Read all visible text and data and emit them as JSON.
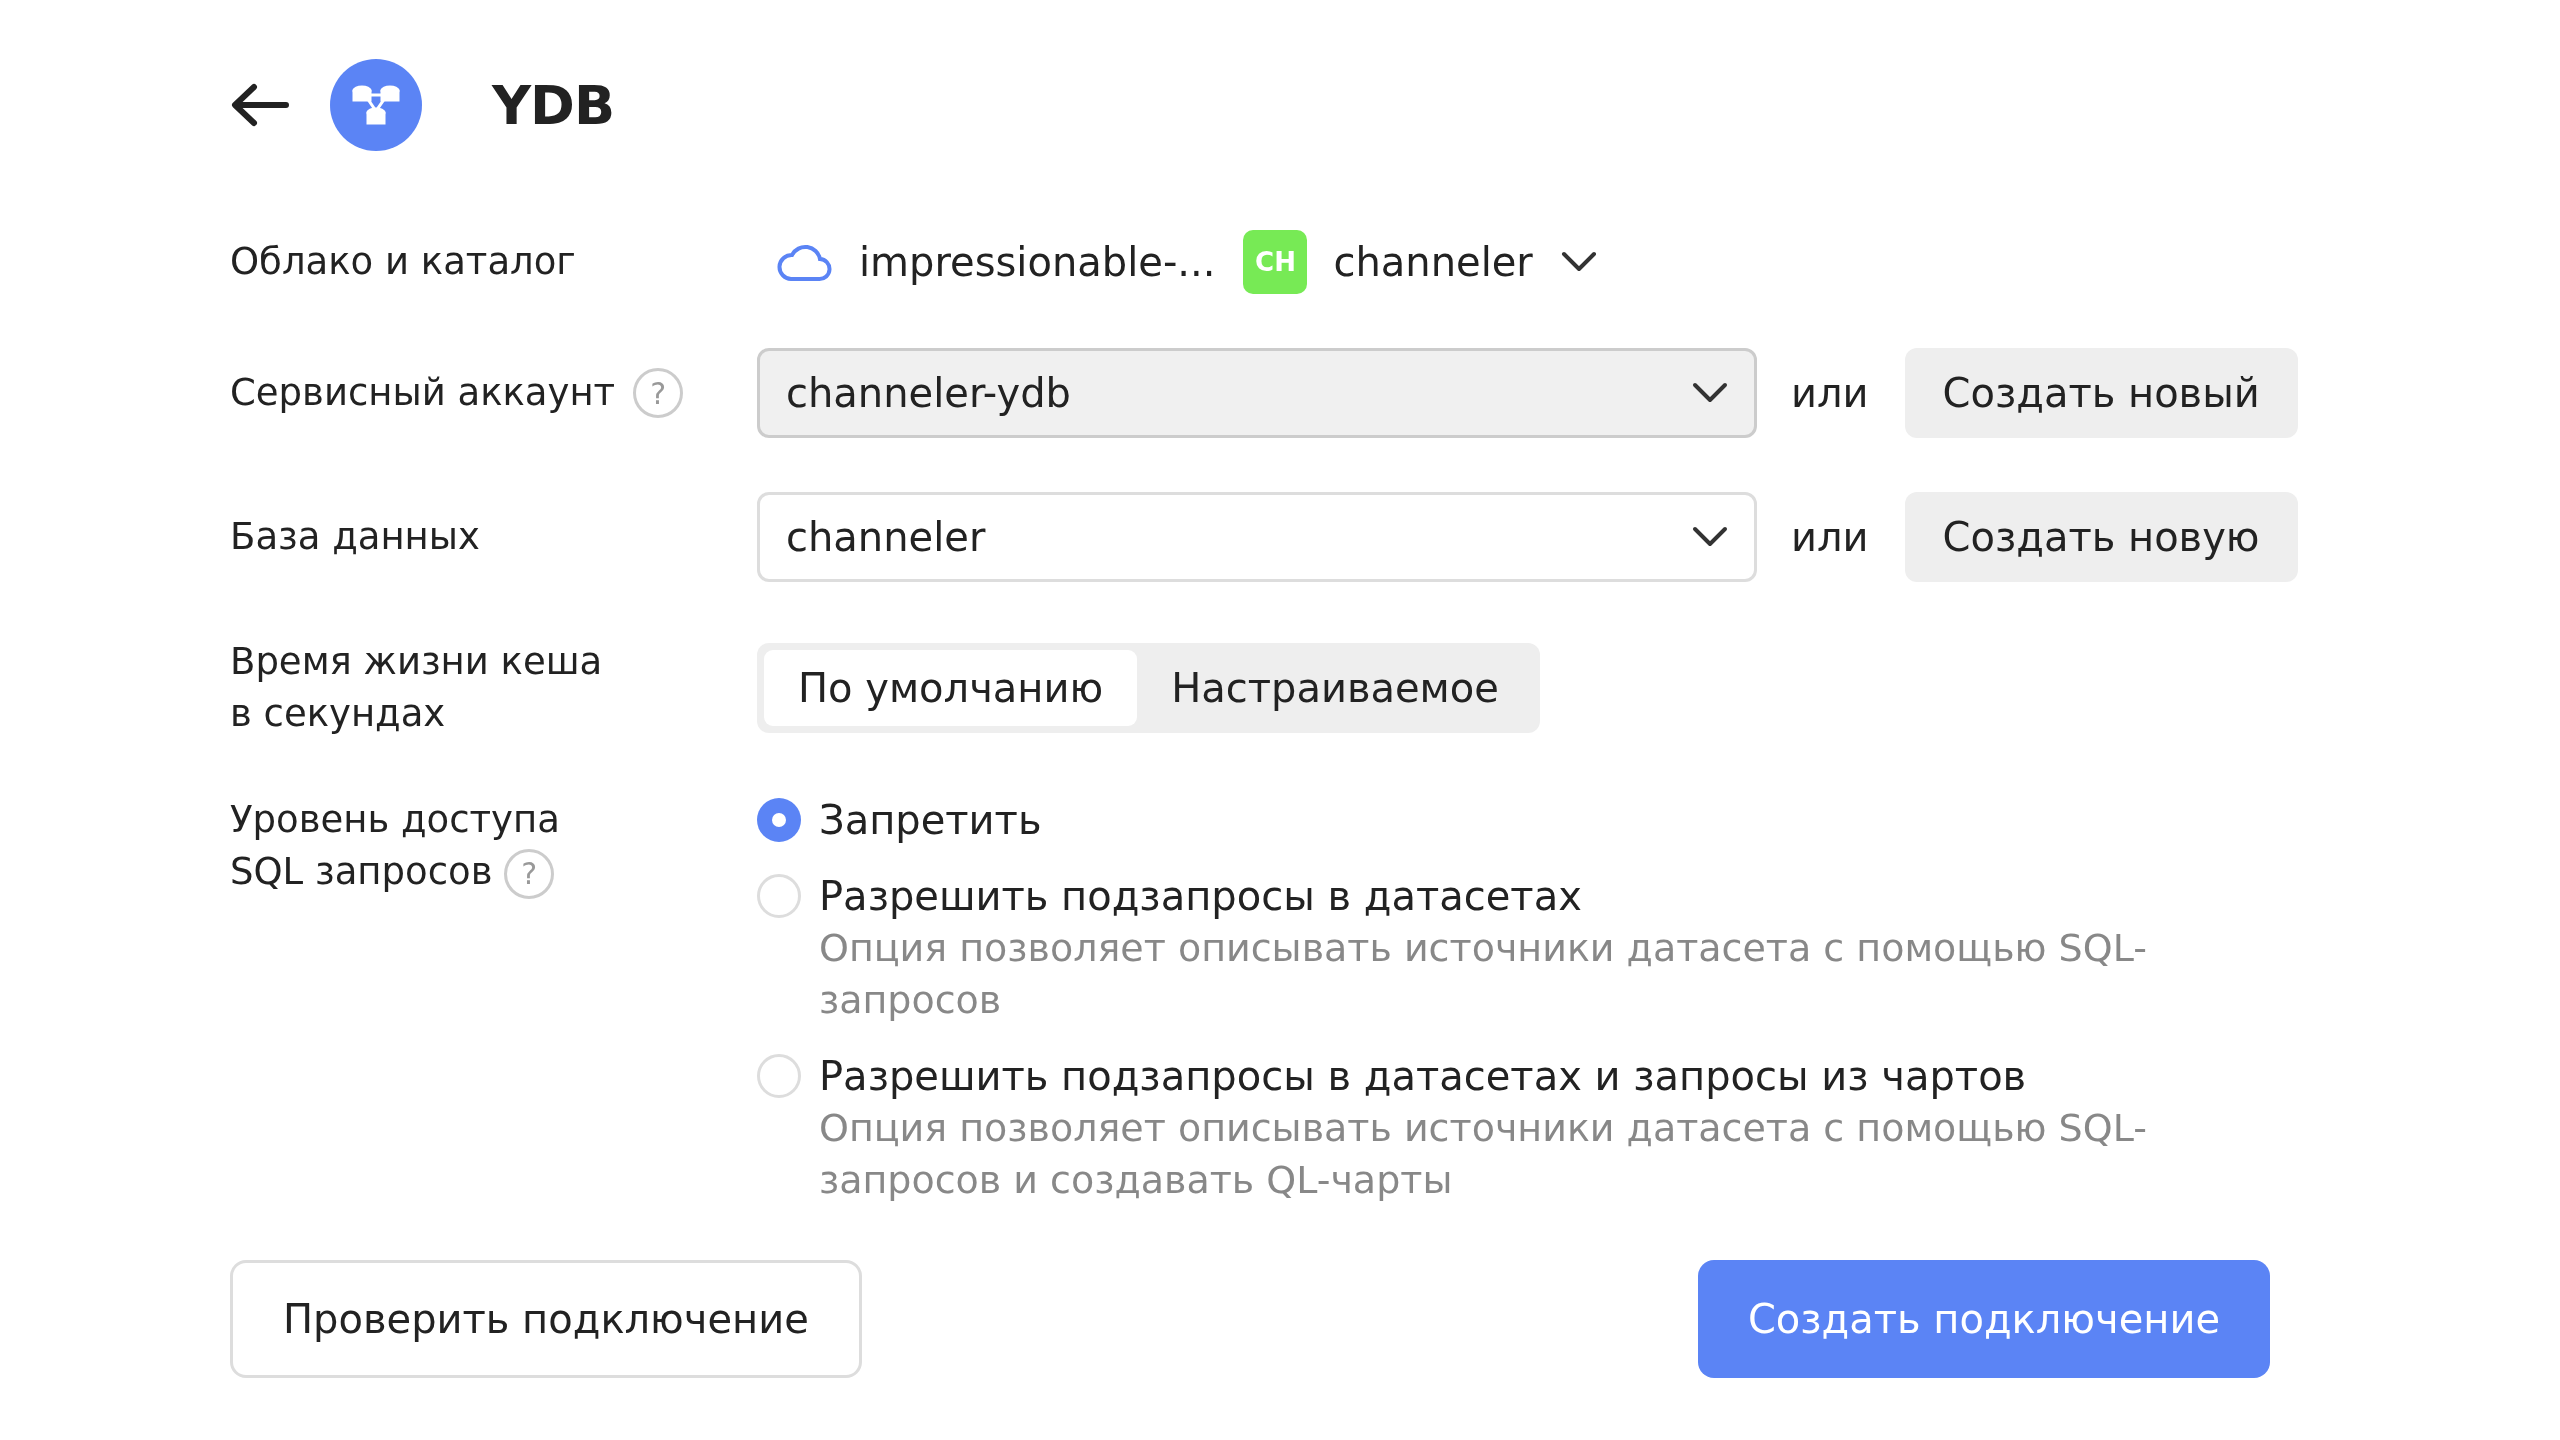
{
  "header": {
    "title": "YDB"
  },
  "cloud_row": {
    "label": "Облако и каталог",
    "cloud": "impressionable-...",
    "folder_badge": "CH",
    "folder": "channeler"
  },
  "service_account": {
    "label": "Сервисный аккаунт",
    "help": "?",
    "value": "channeler-ydb",
    "or": "или",
    "create": "Создать новый"
  },
  "database": {
    "label": "База данных",
    "value": "channeler",
    "or": "или",
    "create": "Создать новую"
  },
  "cache": {
    "label": "Время жизни кеша в секундах",
    "options": [
      {
        "label": "По умолчанию",
        "selected": true
      },
      {
        "label": "Настраиваемое",
        "selected": false
      }
    ]
  },
  "sql_access": {
    "label": "Уровень доступа SQL запросов",
    "help": "?",
    "options": [
      {
        "label": "Запретить",
        "selected": true
      },
      {
        "label": "Разрешить подзапросы в датасетах",
        "description": "Опция позволяет описывать источники датасета с помощью SQL-запросов",
        "selected": false
      },
      {
        "label": "Разрешить подзапросы в датасетах и запросы из чартов",
        "description": "Опция позволяет описывать источники датасета с помощью SQL-запросов и создавать QL-чарты",
        "selected": false
      }
    ]
  },
  "buttons": {
    "check": "Проверить подключение",
    "create": "Создать подключение"
  }
}
